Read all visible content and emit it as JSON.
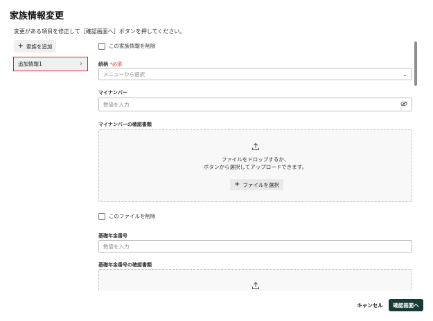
{
  "dialog": {
    "title": "家族情報変更",
    "instruction": "変更がある項目を修正して［確認画面へ］ボタンを押してください。"
  },
  "sidebar": {
    "add_button_label": "家族を追加",
    "items": [
      {
        "label": "追加情報1",
        "selected": true
      }
    ]
  },
  "form": {
    "delete_family_label": "この家族情報を削除",
    "relationship": {
      "label": "続柄",
      "required_mark": "*必須",
      "placeholder": "メニューから選択"
    },
    "my_number": {
      "label": "マイナンバー",
      "placeholder": "数値を入力"
    },
    "my_number_doc": {
      "label": "マイナンバーの確認書類",
      "drop_line1": "ファイルをドロップするか、",
      "drop_line2": "ボタンから選択してアップロードできます。",
      "select_button_label": "ファイルを選択"
    },
    "delete_file_label": "このファイルを削除",
    "pension_number": {
      "label": "基礎年金番号",
      "placeholder": "数値を入力"
    },
    "pension_doc": {
      "label": "基礎年金番号の確認書類"
    }
  },
  "footer": {
    "cancel_label": "キャンセル",
    "confirm_label": "確認画面へ"
  },
  "colors": {
    "primary_button": "#173b35",
    "required": "#d8232a",
    "selected_outline": "#d8232a"
  },
  "icons": {
    "add": "plus-icon",
    "chevron": "chevron-right-icon",
    "dropdown": "chevron-down-icon",
    "visibility": "eye-off-icon",
    "upload": "upload-icon"
  }
}
